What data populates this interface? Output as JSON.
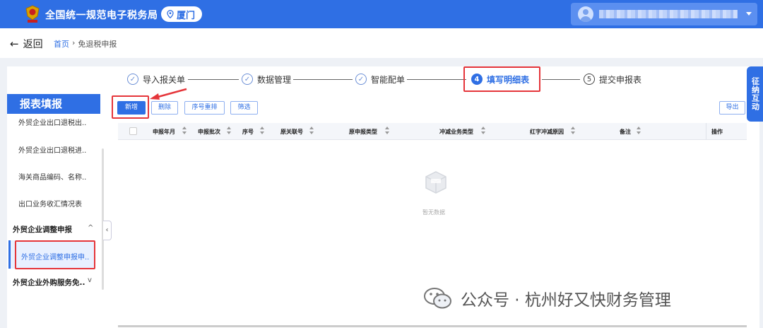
{
  "header": {
    "site_title": "全国统一规范电子税务局",
    "city": "厦门",
    "logo_icon": "tax-emblem-icon",
    "location_icon": "location-pin-icon",
    "user_icon": "user-avatar-icon",
    "caret_icon": "chevron-down-icon"
  },
  "breadcrumb": {
    "back_label": "返回",
    "home": "首页",
    "separator": "›",
    "current": "免退税申报"
  },
  "steps": [
    {
      "index": "✓",
      "label": "导入报关单",
      "status": "done"
    },
    {
      "index": "✓",
      "label": "数据管理",
      "status": "done"
    },
    {
      "index": "✓",
      "label": "智能配单",
      "status": "done"
    },
    {
      "index": "4",
      "label": "填写明细表",
      "status": "active"
    },
    {
      "index": "5",
      "label": "提交申报表",
      "status": "todo"
    }
  ],
  "sidebar": {
    "title": "报表填报",
    "items": [
      "外贸企业出口退税出..",
      "外贸企业出口退税进..",
      "海关商品编码、名称..",
      "出口业务收汇情况表"
    ],
    "group1": "外贸企业调整申报",
    "group1_caret": "^",
    "active_item": "外贸企业调整申报申..",
    "group2": "外贸企业外购服务免..",
    "group2_caret": "v",
    "collapse": "‹"
  },
  "toolbar": {
    "add": "新增",
    "delete": "删除",
    "reorder": "序号重排",
    "filter": "筛选",
    "export": "导出"
  },
  "table": {
    "columns": [
      "申报年月",
      "申报批次",
      "序号",
      "原关联号",
      "原申报类型",
      "冲减业务类型",
      "红字冲减原因",
      "备注",
      "操作"
    ],
    "empty_text": "暂无数据"
  },
  "float_tab": "征纳互动",
  "watermark": "公众号 · 杭州好又快财务管理",
  "colors": {
    "brand": "#2f6fe4",
    "highlight": "#e5353a"
  }
}
